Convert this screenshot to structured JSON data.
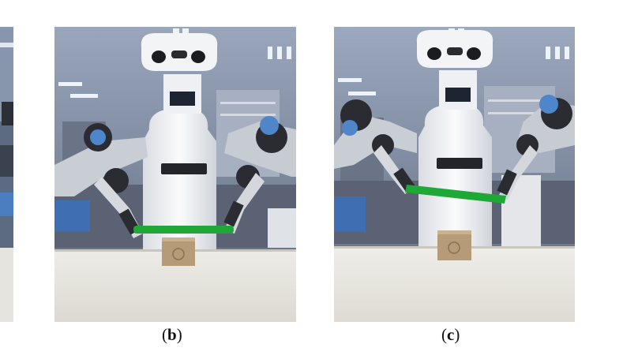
{
  "figure": {
    "panels": [
      {
        "id": "a",
        "label": "",
        "description_icon": "robot-lab-photo-icon"
      },
      {
        "id": "b",
        "label": "b",
        "description_icon": "robot-lab-photo-icon"
      },
      {
        "id": "c",
        "label": "c",
        "description_icon": "robot-lab-photo-icon"
      }
    ]
  },
  "colors": {
    "stick_green": "#1fa836",
    "table_white": "#e9e7e2",
    "robot_white": "#f1f2f4",
    "arm_blue": "#4e86c9",
    "arm_black": "#2a2c31",
    "box_tan": "#b59b78"
  }
}
